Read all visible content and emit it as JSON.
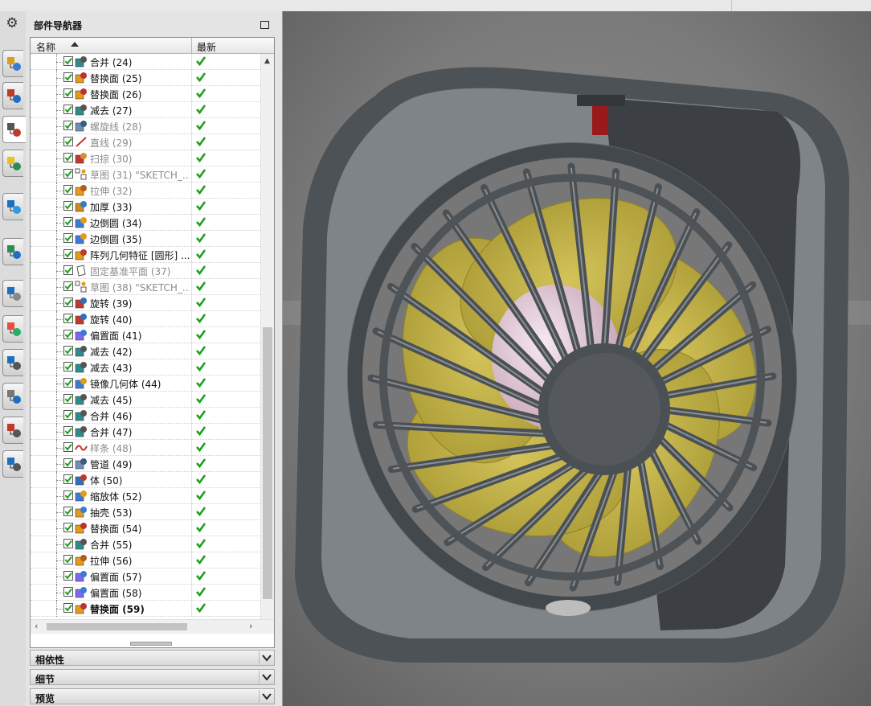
{
  "navigator": {
    "title": "部件导航器",
    "columns": {
      "name": "名称",
      "latest": "最新"
    },
    "rows": [
      {
        "label": "合并 (24)",
        "icon": "unite-icon",
        "dim": false
      },
      {
        "label": "替换面 (25)",
        "icon": "replace-face-icon",
        "dim": false
      },
      {
        "label": "替换面 (26)",
        "icon": "replace-face-icon",
        "dim": false
      },
      {
        "label": "减去 (27)",
        "icon": "subtract-icon",
        "dim": false
      },
      {
        "label": "螺旋线 (28)",
        "icon": "helix-icon",
        "dim": true
      },
      {
        "label": "直线 (29)",
        "icon": "line-icon",
        "dim": true
      },
      {
        "label": "扫掠 (30)",
        "icon": "swept-icon",
        "dim": true
      },
      {
        "label": "草图 (31) \"SKETCH_...",
        "icon": "sketch-icon",
        "dim": true
      },
      {
        "label": "拉伸 (32)",
        "icon": "extrude-icon",
        "dim": true
      },
      {
        "label": "加厚 (33)",
        "icon": "thicken-icon",
        "dim": false
      },
      {
        "label": "边倒圆 (34)",
        "icon": "edge-blend-icon",
        "dim": false
      },
      {
        "label": "边倒圆 (35)",
        "icon": "edge-blend-icon",
        "dim": false
      },
      {
        "label": "阵列几何特征 [圆形] ...",
        "icon": "pattern-geometry-icon",
        "dim": false
      },
      {
        "label": "固定基准平面 (37)",
        "icon": "datum-plane-icon",
        "dim": true
      },
      {
        "label": "草图 (38) \"SKETCH_...",
        "icon": "sketch-icon",
        "dim": true
      },
      {
        "label": "旋转 (39)",
        "icon": "revolve-icon",
        "dim": false
      },
      {
        "label": "旋转 (40)",
        "icon": "revolve-icon",
        "dim": false
      },
      {
        "label": "偏置面 (41)",
        "icon": "offset-face-icon",
        "dim": false
      },
      {
        "label": "减去 (42)",
        "icon": "subtract-icon",
        "dim": false
      },
      {
        "label": "减去 (43)",
        "icon": "subtract-icon",
        "dim": false
      },
      {
        "label": "镜像几何体 (44)",
        "icon": "mirror-geometry-icon",
        "dim": false
      },
      {
        "label": "减去 (45)",
        "icon": "subtract-icon",
        "dim": false
      },
      {
        "label": "合并 (46)",
        "icon": "unite-icon",
        "dim": false
      },
      {
        "label": "合并 (47)",
        "icon": "unite-icon",
        "dim": false
      },
      {
        "label": "样条 (48)",
        "icon": "spline-icon",
        "dim": true
      },
      {
        "label": "管道 (49)",
        "icon": "tube-icon",
        "dim": false
      },
      {
        "label": "体 (50)",
        "icon": "body-icon",
        "dim": false
      },
      {
        "label": "缩放体 (52)",
        "icon": "scale-body-icon",
        "dim": false
      },
      {
        "label": "抽壳 (53)",
        "icon": "shell-icon",
        "dim": false
      },
      {
        "label": "替换面 (54)",
        "icon": "replace-face-icon",
        "dim": false
      },
      {
        "label": "合并 (55)",
        "icon": "unite-icon",
        "dim": false
      },
      {
        "label": "拉伸 (56)",
        "icon": "extrude-icon",
        "dim": false
      },
      {
        "label": "偏置面 (57)",
        "icon": "offset-face-icon",
        "dim": false
      },
      {
        "label": "偏置面 (58)",
        "icon": "offset-face-icon",
        "dim": false
      },
      {
        "label": "替换面 (59)",
        "icon": "replace-face-icon",
        "dim": false,
        "bold": true
      }
    ]
  },
  "panels": {
    "dependencies": "相依性",
    "details": "细节",
    "preview": "预览"
  },
  "colors": {
    "check_green": "#1ea01e",
    "fan_blade": "#b5a43a",
    "fan_frame": "#5f6468"
  },
  "icons": {
    "settings": "gear-icon",
    "resource_tabs": [
      "assembly-navigator-icon",
      "constraint-navigator-icon",
      "part-navigator-icon",
      "reuse-library-icon",
      "hd3d-tools-icon",
      "web-browser-icon",
      "history-icon",
      "visualization-icon",
      "process-studio-icon",
      "roles-icon",
      "system-materials-icon",
      "reports-icon"
    ]
  }
}
